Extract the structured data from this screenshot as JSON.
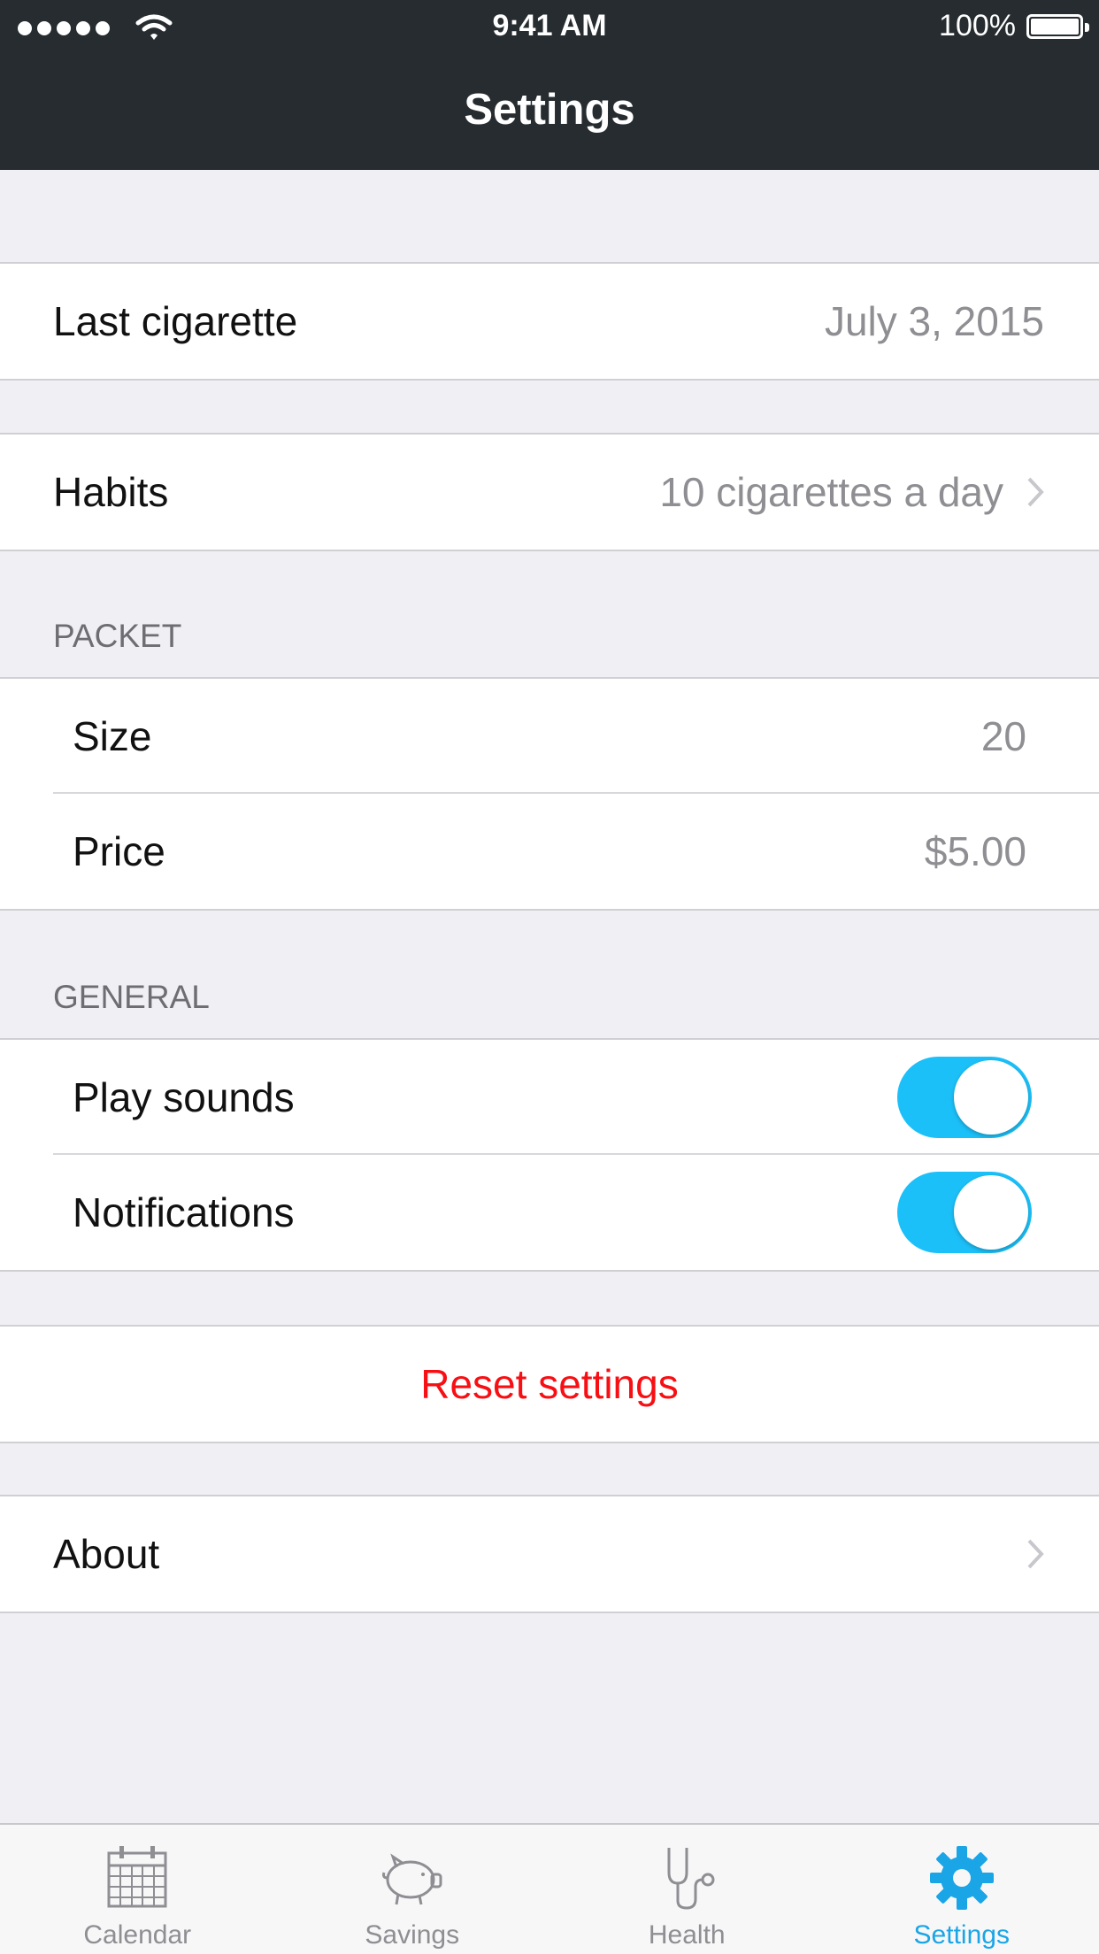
{
  "status": {
    "time": "9:41 AM",
    "battery": "100%"
  },
  "nav": {
    "title": "Settings"
  },
  "rows": {
    "last_cigarette": {
      "label": "Last cigarette",
      "value": "July 3, 2015"
    },
    "habits": {
      "label": "Habits",
      "value": "10 cigarettes a day"
    }
  },
  "packet": {
    "header": "PACKET",
    "size": {
      "label": "Size",
      "value": "20"
    },
    "price": {
      "label": "Price",
      "value": "$5.00"
    }
  },
  "general": {
    "header": "GENERAL",
    "play_sounds": {
      "label": "Play sounds",
      "on": true
    },
    "notifications": {
      "label": "Notifications",
      "on": true
    }
  },
  "reset": {
    "label": "Reset settings"
  },
  "about": {
    "label": "About"
  },
  "tabs": [
    {
      "label": "Calendar",
      "icon": "calendar-icon",
      "active": false
    },
    {
      "label": "Savings",
      "icon": "piggy-bank-icon",
      "active": false
    },
    {
      "label": "Health",
      "icon": "stethoscope-icon",
      "active": false
    },
    {
      "label": "Settings",
      "icon": "gear-icon",
      "active": true
    }
  ],
  "colors": {
    "toggle_on": "#1cc0f8",
    "destructive": "#f70f13",
    "tab_active": "#1aa5e7",
    "navbar": "#262c2f"
  }
}
